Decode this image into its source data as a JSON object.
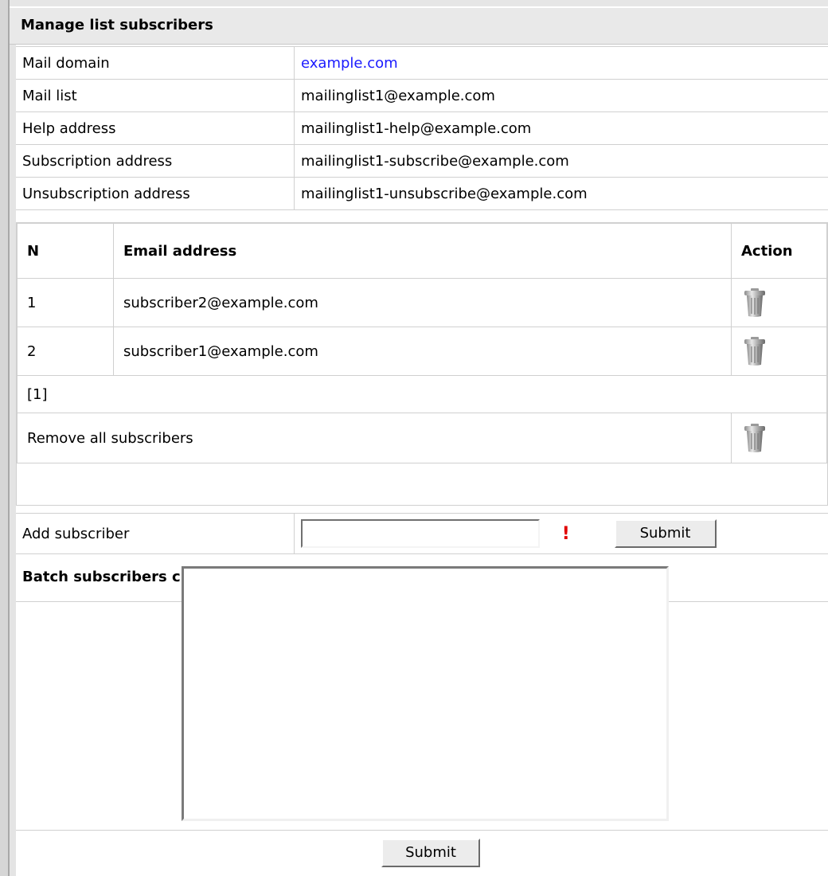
{
  "panel": {
    "title": "Manage list subscribers"
  },
  "info": {
    "mail_domain_label": "Mail domain",
    "mail_domain_value": "example.com",
    "mail_list_label": "Mail list",
    "mail_list_value": "mailinglist1@example.com",
    "help_label": "Help address",
    "help_value": "mailinglist1-help@example.com",
    "subscribe_label": "Subscription address",
    "subscribe_value": "mailinglist1-subscribe@example.com",
    "unsubscribe_label": "Unsubscription address",
    "unsubscribe_value": "mailinglist1-unsubscribe@example.com"
  },
  "subscribers": {
    "headers": {
      "n": "N",
      "email": "Email address",
      "action": "Action"
    },
    "rows": [
      {
        "n": "1",
        "email": "subscriber2@example.com",
        "action_icon": "trash-icon"
      },
      {
        "n": "2",
        "email": "subscriber1@example.com",
        "action_icon": "trash-icon"
      }
    ],
    "pager": "[1]",
    "remove_all_label": "Remove all subscribers"
  },
  "add_subscriber": {
    "label": "Add subscriber",
    "value": "",
    "required_mark": "!",
    "submit_label": "Submit"
  },
  "batch": {
    "title": "Batch subscribers creation",
    "value": "",
    "submit_label": "Submit"
  },
  "colors": {
    "link": "#1a1aff",
    "required": "#e10000",
    "title_bar_bg": "#e9e9e9",
    "border": "#d0d0d0"
  }
}
